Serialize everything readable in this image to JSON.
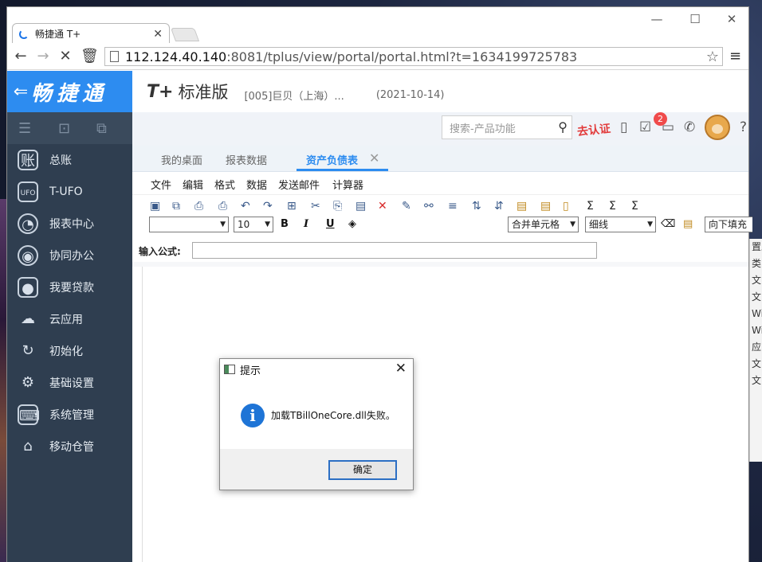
{
  "browser": {
    "tab_title": "畅捷通 T+",
    "url_host": "112.124.40.140",
    "url_rest": ":8081/tplus/view/portal/portal.html?t=1634199725783"
  },
  "app": {
    "brand": "畅捷通",
    "product_logo": "T+",
    "product_name": "标准版",
    "company": "[005]巨贝（上海）...",
    "date": "(2021-10-14)",
    "search_placeholder": "搜索-产品功能",
    "verify_label": "去认证",
    "notification_count": "2"
  },
  "sidebar": {
    "items": [
      {
        "label": "总账",
        "icon": "ledger-icon"
      },
      {
        "label": "T-UFO",
        "icon": "ufo-icon"
      },
      {
        "label": "报表中心",
        "icon": "report-icon"
      },
      {
        "label": "协同办公",
        "icon": "collab-icon"
      },
      {
        "label": "我要贷款",
        "icon": "loan-icon"
      },
      {
        "label": "云应用",
        "icon": "cloud-icon"
      },
      {
        "label": "初始化",
        "icon": "init-icon"
      },
      {
        "label": "基础设置",
        "icon": "settings-icon"
      },
      {
        "label": "系统管理",
        "icon": "system-icon"
      },
      {
        "label": "移动仓管",
        "icon": "warehouse-icon"
      }
    ]
  },
  "tabs": [
    {
      "label": "我的桌面"
    },
    {
      "label": "报表数据"
    },
    {
      "label": "资产负债表"
    }
  ],
  "menu": [
    "文件",
    "编辑",
    "格式",
    "数据",
    "发送邮件",
    "计算器"
  ],
  "format": {
    "font_size": "10",
    "merge_option": "合并单元格",
    "line_option": "细线",
    "fill_option": "向下填充",
    "bold": "B",
    "italic": "I",
    "underline": "U"
  },
  "formula": {
    "label": "输入公式:"
  },
  "dialog": {
    "title": "提示",
    "message": "加载TBillOneCore.dll失败。",
    "ok_label": "确定"
  },
  "background_window": [
    "置工",
    "类",
    "文",
    "文",
    "Wi",
    "Wi",
    "应",
    "文",
    "文"
  ]
}
